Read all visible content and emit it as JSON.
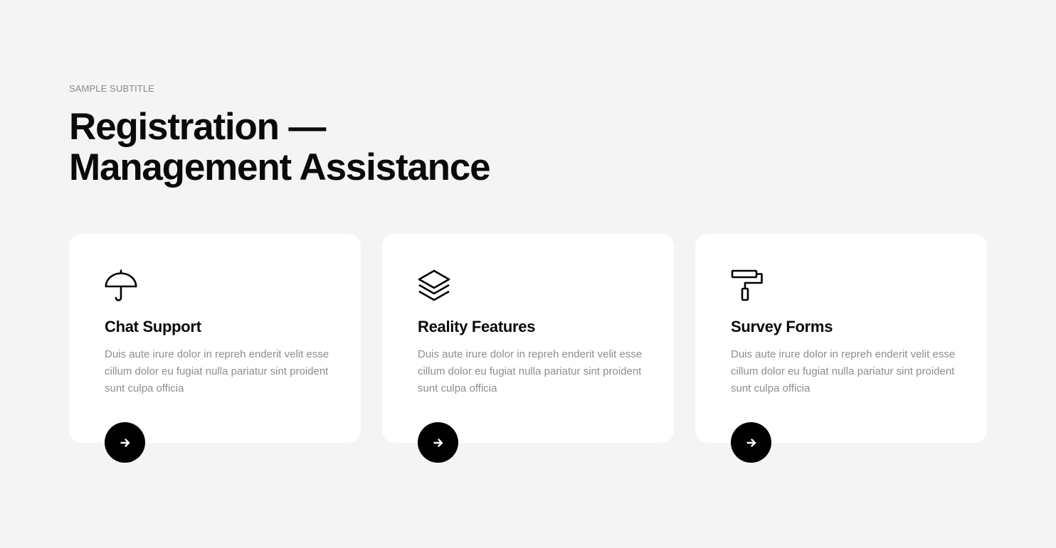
{
  "section": {
    "subtitle": "SAMPLE SUBTITLE",
    "heading_line1": "Registration —",
    "heading_line2": "Management Assistance"
  },
  "cards": [
    {
      "icon": "umbrella-icon",
      "title": "Chat Support",
      "text": "Duis aute irure dolor in repreh enderit velit esse cillum dolor eu fugiat nulla pariatur sint proident sunt culpa officia",
      "button_icon": "arrow-right-icon"
    },
    {
      "icon": "layers-icon",
      "title": "Reality Features",
      "text": "Duis aute irure dolor in repreh enderit velit esse cillum dolor eu fugiat nulla pariatur sint proident sunt culpa officia",
      "button_icon": "arrow-right-icon"
    },
    {
      "icon": "paint-roller-icon",
      "title": "Survey Forms",
      "text": "Duis aute irure dolor in repreh enderit velit esse cillum dolor eu fugiat nulla pariatur sint proident sunt culpa officia",
      "button_icon": "arrow-right-icon"
    }
  ],
  "colors": {
    "background": "#f4f4f4",
    "card": "#ffffff",
    "heading": "#0a0a0a",
    "body_text": "#8e8e8e",
    "button": "#000000"
  }
}
